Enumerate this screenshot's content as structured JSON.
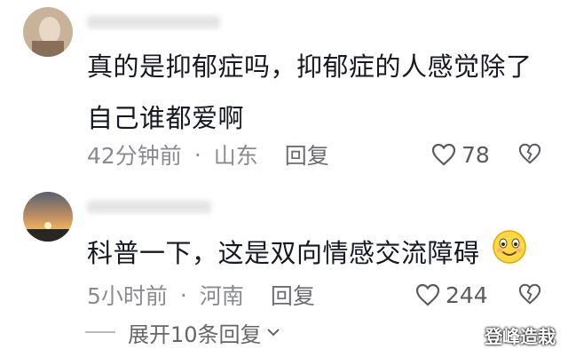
{
  "comments": [
    {
      "text_line1": "真的是抑郁症吗，抑郁症的人感觉除了",
      "text_line2": "自己谁都爱啊",
      "time": "42分钟前",
      "location": "山东",
      "reply_label": "回复",
      "likes": "78"
    },
    {
      "text": "科普一下，这是双向情感交流障碍",
      "emoji": "smile-emoji",
      "time": "5小时前",
      "location": "河南",
      "reply_label": "回复",
      "likes": "244"
    }
  ],
  "expand_label": "展开10条回复",
  "watermark": "登峰造栽",
  "colors": {
    "text": "#161823",
    "meta": "#8a8b91",
    "divider": "#bdbdbd"
  }
}
